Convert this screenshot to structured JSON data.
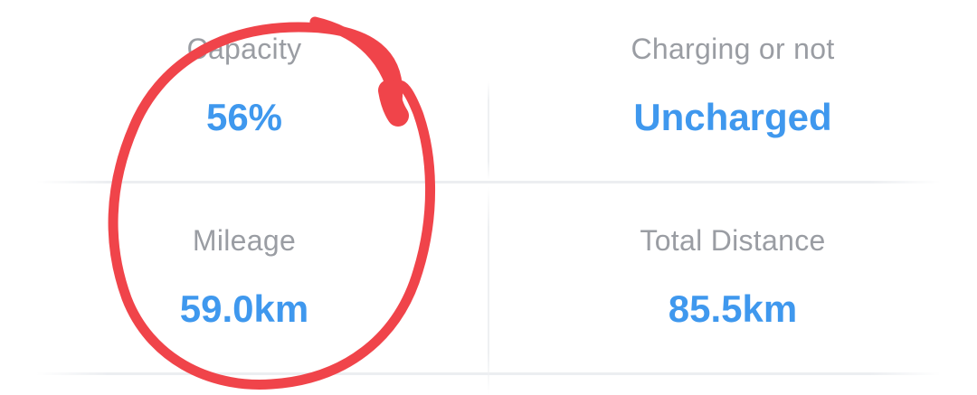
{
  "stats": {
    "capacity": {
      "label": "Capacity",
      "value": "56%"
    },
    "charging": {
      "label": "Charging or not",
      "value": "Uncharged"
    },
    "mileage": {
      "label": "Mileage",
      "value": "59.0km"
    },
    "total_distance": {
      "label": "Total Distance",
      "value": "85.5km"
    }
  },
  "colors": {
    "label": "#9a9da3",
    "value": "#3f98ee",
    "annotation": "#f0444a"
  },
  "annotation": {
    "shape": "hand-drawn circle",
    "target": "capacity and mileage"
  }
}
